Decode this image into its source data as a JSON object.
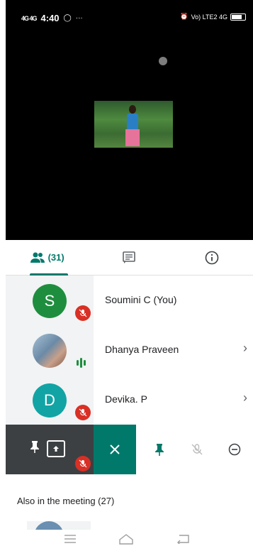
{
  "status_bar": {
    "time": "4:40",
    "signal_left": "4G 4G",
    "right_label": "Vo) LTE2 4G",
    "battery": "47"
  },
  "tabs": [
    {
      "name": "people",
      "label": "(31)"
    },
    {
      "name": "chat",
      "label": ""
    },
    {
      "name": "info",
      "label": ""
    }
  ],
  "participants": [
    {
      "initial": "S",
      "name": "Soumini C (You)",
      "avatar_color": "#1e8e3e",
      "status": "muted"
    },
    {
      "initial": "",
      "name": "Dhanya Praveen",
      "avatar_color": "#8aa4bf",
      "status": "speaking"
    },
    {
      "initial": "D",
      "name": "Devika. P",
      "avatar_color": "#12a4a4",
      "status": "muted"
    }
  ],
  "also_in_meeting": "Also in the meeting (27)",
  "colors": {
    "accent": "#00796b",
    "muted_red": "#d93025"
  }
}
